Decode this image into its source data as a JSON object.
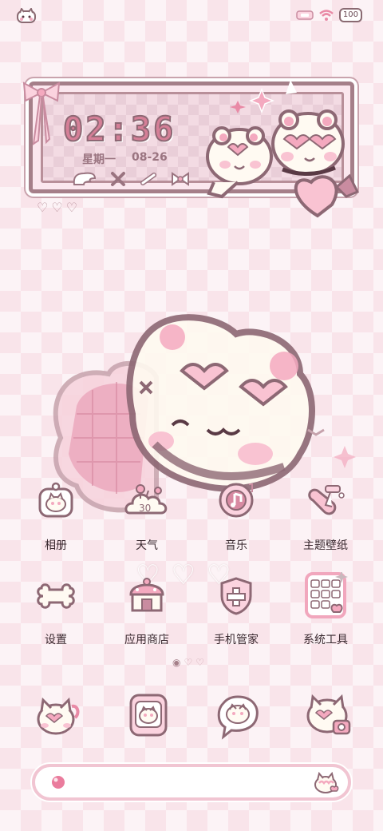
{
  "status_bar": {
    "battery": "100"
  },
  "clock_widget": {
    "time": "02:36",
    "weekday": "星期一",
    "date": "08-26"
  },
  "apps": [
    {
      "label": "相册",
      "icon": "photo-album-icon"
    },
    {
      "label": "天气",
      "icon": "weather-icon",
      "badge": "30"
    },
    {
      "label": "音乐",
      "icon": "music-icon"
    },
    {
      "label": "主题壁纸",
      "icon": "theme-wallpaper-icon"
    },
    {
      "label": "设置",
      "icon": "settings-bone-icon"
    },
    {
      "label": "应用商店",
      "icon": "app-store-icon"
    },
    {
      "label": "手机管家",
      "icon": "phone-manager-icon"
    },
    {
      "label": "系统工具",
      "icon": "system-tools-icon"
    }
  ],
  "dock": [
    {
      "icon": "phone-cat-icon"
    },
    {
      "icon": "messages-cat-icon"
    },
    {
      "icon": "chat-bubble-cat-icon"
    },
    {
      "icon": "camera-cat-icon"
    }
  ],
  "colors": {
    "background": "#f9e4ea",
    "frame": "#a57f89",
    "accent_pink": "#f4a9bf",
    "text": "#3a2a30"
  }
}
